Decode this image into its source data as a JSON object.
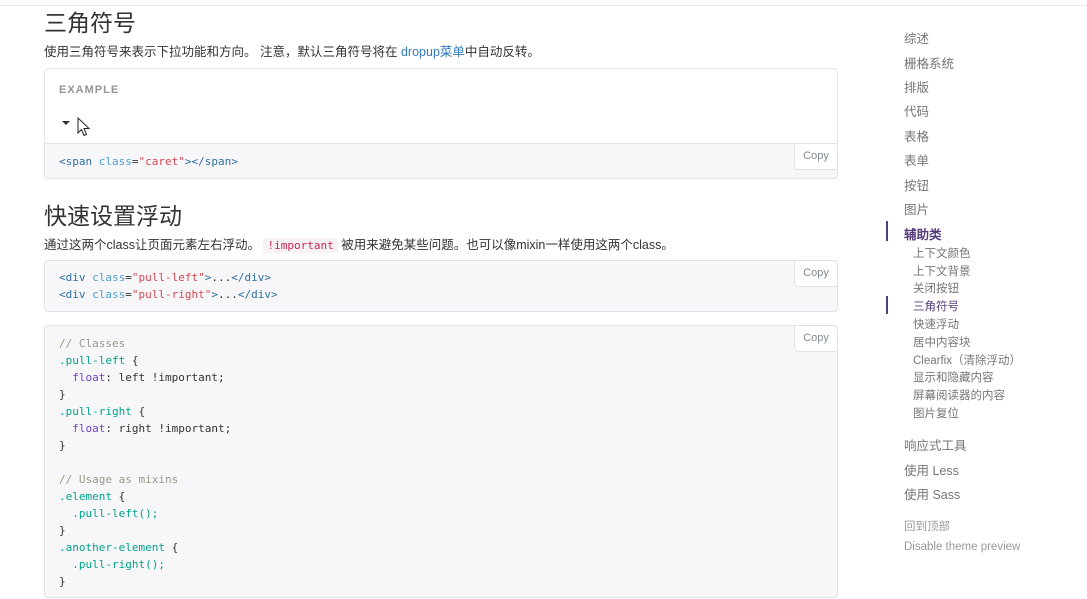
{
  "caret_section": {
    "title": "三角符号",
    "desc_before": "使用三角符号来表示下拉功能和方向。 注意，默认三角符号将在",
    "desc_link": "dropup菜单",
    "desc_after": "中自动反转。",
    "example_label": "EXAMPLE",
    "code": {
      "tag": "span",
      "attr": "class",
      "value": "\"caret\""
    },
    "copy_label": "Copy"
  },
  "float_section": {
    "title": "快速设置浮动",
    "desc_before": "通过这两个class让页面元素左右浮动。",
    "desc_code": "!important",
    "desc_after": "被用来避免某些问题。也可以像mixin一样使用这两个class。",
    "code1": {
      "tag": "div",
      "attr": "class",
      "line1_value": "\"pull-left\"",
      "line2_value": "\"pull-right\"",
      "ellipsis": "..."
    },
    "code2": {
      "comment1": "// Classes",
      "sel1": ".pull-left",
      "prop": "float",
      "val1": "left !important;",
      "sel2": ".pull-right",
      "val2": "right !important;",
      "comment2": "// Usage as mixins",
      "sel3": ".element",
      "call1": ".pull-left();",
      "sel4": ".another-element",
      "call2": ".pull-right();"
    },
    "copy_label": "Copy"
  },
  "sidebar": {
    "items": [
      "综述",
      "栅格系统",
      "排版",
      "代码",
      "表格",
      "表单",
      "按钮",
      "图片",
      "辅助类"
    ],
    "subitems": [
      "上下文颜色",
      "上下文背景",
      "关闭按钮",
      "三角符号",
      "快速浮动",
      "居中内容块",
      "Clearfix（清除浮动）",
      "显示和隐藏内容",
      "屏幕阅读器的内容",
      "图片复位"
    ],
    "after_items": [
      "响应式工具",
      "使用 Less",
      "使用 Sass"
    ],
    "back_to_top": "回到顶部",
    "disable_preview": "Disable theme preview",
    "accent_color": "#563d7c"
  }
}
